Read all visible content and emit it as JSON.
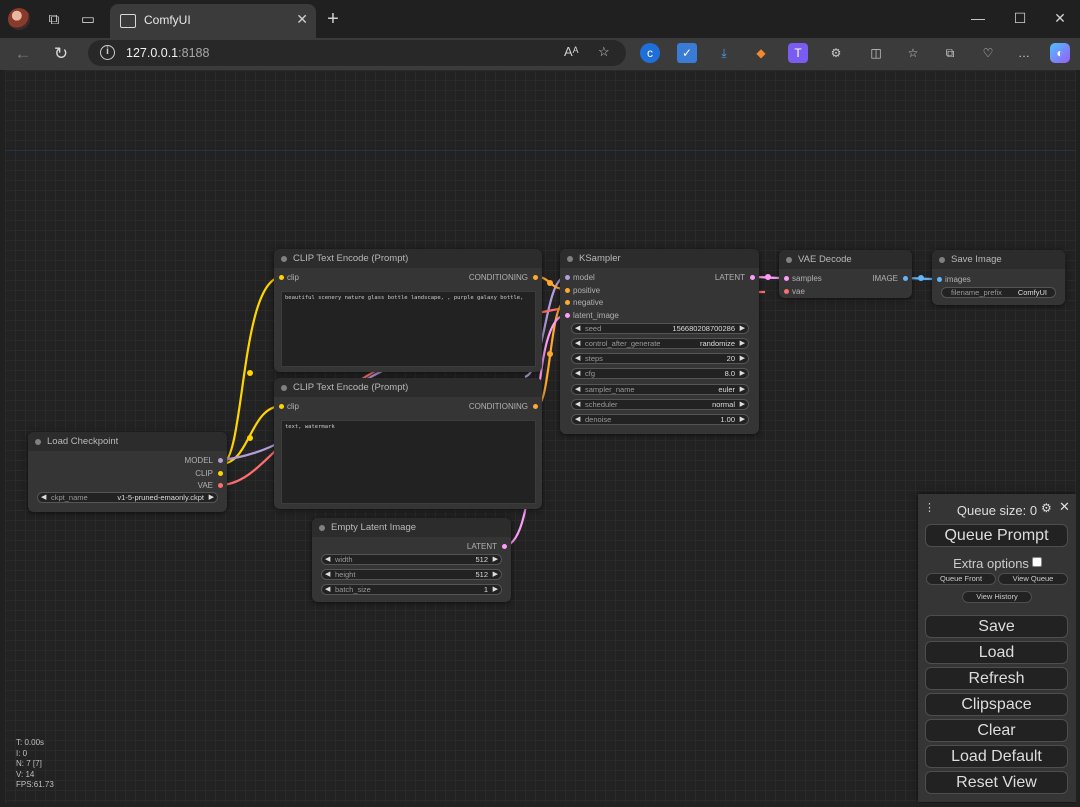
{
  "tab": {
    "title": "ComfyUI"
  },
  "address": {
    "host": "127.0.0.1",
    "port": ":8188"
  },
  "colors": {
    "model": "#b39ddb",
    "clip": "#ffd500",
    "vae": "#ff6e6e",
    "conditioning": "#ffa931",
    "latent": "#ff9cf9",
    "image": "#64b5f6"
  },
  "nodes": {
    "clip_pos": {
      "title": "CLIP Text Encode (Prompt)",
      "input": "clip",
      "output": "CONDITIONING",
      "text": "beautiful scenery nature glass bottle landscape, , purple galaxy bottle,"
    },
    "clip_neg": {
      "title": "CLIP Text Encode (Prompt)",
      "input": "clip",
      "output": "CONDITIONING",
      "text": "text, watermark"
    },
    "ksampler": {
      "title": "KSampler",
      "inputs": [
        "model",
        "positive",
        "negative",
        "latent_image"
      ],
      "output": "LATENT",
      "widgets": [
        {
          "name": "seed",
          "value": "156680208700286"
        },
        {
          "name": "control_after_generate",
          "value": "randomize"
        },
        {
          "name": "steps",
          "value": "20"
        },
        {
          "name": "cfg",
          "value": "8.0"
        },
        {
          "name": "sampler_name",
          "value": "euler"
        },
        {
          "name": "scheduler",
          "value": "normal"
        },
        {
          "name": "denoise",
          "value": "1.00"
        }
      ]
    },
    "vae_decode": {
      "title": "VAE Decode",
      "inputs": [
        "samples",
        "vae"
      ],
      "output": "IMAGE"
    },
    "save_image": {
      "title": "Save Image",
      "input": "images",
      "widget": {
        "name": "filename_prefix",
        "value": "ComfyUI"
      }
    },
    "load_checkpoint": {
      "title": "Load Checkpoint",
      "outputs": [
        "MODEL",
        "CLIP",
        "VAE"
      ],
      "widget": {
        "name": "ckpt_name",
        "value": "v1-5-pruned-emaonly.ckpt"
      }
    },
    "empty_latent": {
      "title": "Empty Latent Image",
      "output": "LATENT",
      "widgets": [
        {
          "name": "width",
          "value": "512"
        },
        {
          "name": "height",
          "value": "512"
        },
        {
          "name": "batch_size",
          "value": "1"
        }
      ]
    }
  },
  "stats": [
    "T: 0.00s",
    "I: 0",
    "N: 7 [7]",
    "V: 14",
    "FPS:61.73"
  ],
  "menu": {
    "queue_size": "Queue size: 0",
    "queue_prompt": "Queue Prompt",
    "extra_options": "Extra options",
    "queue_front": "Queue Front",
    "view_queue": "View Queue",
    "view_history": "View History",
    "save": "Save",
    "load": "Load",
    "refresh": "Refresh",
    "clipspace": "Clipspace",
    "clear": "Clear",
    "load_default": "Load Default",
    "reset_view": "Reset View"
  }
}
